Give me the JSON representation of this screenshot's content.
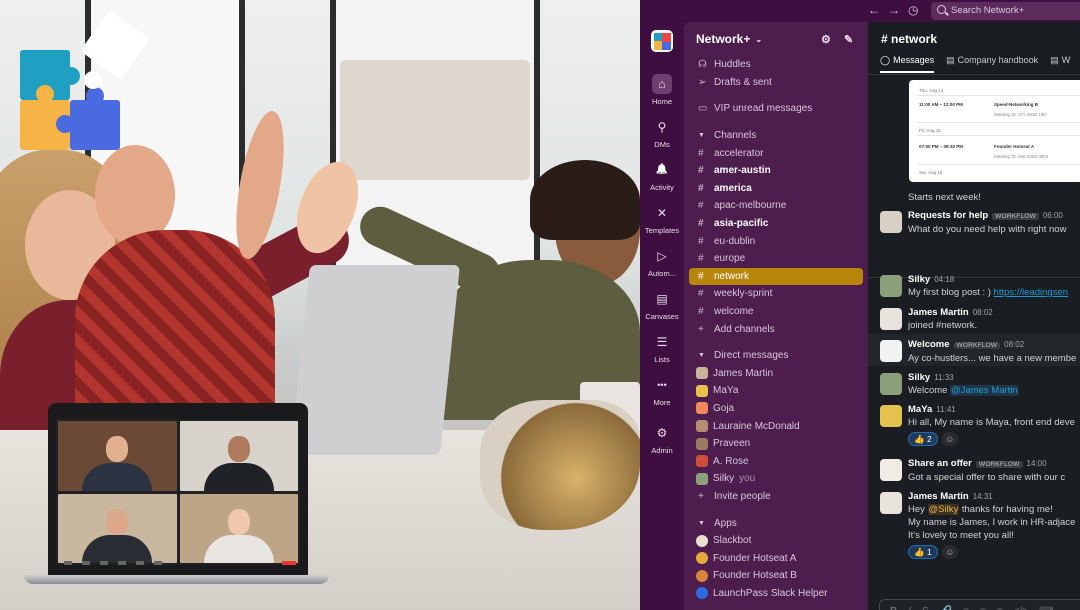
{
  "app": {
    "search_placeholder": "Search Network+",
    "workspace_name": "Network+"
  },
  "rail": [
    {
      "label": "Home",
      "icon": "home-icon"
    },
    {
      "label": "DMs",
      "icon": "dm-icon"
    },
    {
      "label": "Activity",
      "icon": "bell-icon"
    },
    {
      "label": "Templates",
      "icon": "templates-icon"
    },
    {
      "label": "Autom...",
      "icon": "automation-icon"
    },
    {
      "label": "Canvases",
      "icon": "canvas-icon"
    },
    {
      "label": "Lists",
      "icon": "list-icon"
    },
    {
      "label": "More",
      "icon": "more-icon"
    },
    {
      "label": "Admin",
      "icon": "gear-icon"
    }
  ],
  "sidebar": {
    "top_items": [
      "Huddles",
      "Drafts & sent"
    ],
    "vip": "VIP unread messages",
    "channels_header": "Channels",
    "channels": [
      {
        "name": "accelerator",
        "bold": false
      },
      {
        "name": "amer-austin",
        "bold": true
      },
      {
        "name": "america",
        "bold": true
      },
      {
        "name": "apac-melbourne",
        "bold": false
      },
      {
        "name": "asia-pacific",
        "bold": true
      },
      {
        "name": "eu-dublin",
        "bold": false
      },
      {
        "name": "europe",
        "bold": false
      },
      {
        "name": "network",
        "bold": false
      },
      {
        "name": "weekly-sprint",
        "bold": false
      },
      {
        "name": "welcome",
        "bold": false
      }
    ],
    "add_channels": "Add channels",
    "dm_header": "Direct messages",
    "dms": [
      "James Martin",
      "MaYa",
      "Goja",
      "Lauraine McDonald",
      "Praveen",
      "A. Rose",
      "Silky"
    ],
    "dm_you": "you",
    "invite": "Invite people",
    "apps_header": "Apps",
    "apps": [
      "Slackbot",
      "Founder Hotseat A",
      "Founder Hotseat B",
      "LaunchPass Slack Helper"
    ]
  },
  "channel": {
    "title": "# network",
    "tabs": [
      "Messages",
      "Company handbook",
      "W"
    ]
  },
  "schedule_card": {
    "day1": "Thu, Aug 14",
    "row1_time": "11:00 AM – 12:00 PM",
    "row1_title": "Speed-Networking B",
    "row1_meta": "Meeting ID: 872 8030 160",
    "day2": "Fri, Aug 15",
    "row2_time": "07:00 PM – 08:30 PM",
    "row2_title": "Founder Hotseat A",
    "row2_meta": "Meeting ID: 846 6200 0802",
    "day3": "Sat, Aug 16"
  },
  "messages": {
    "starts": "Starts next week!",
    "m1": {
      "name": "Requests for help",
      "badge": "WORKFLOW",
      "time": "06:00",
      "text": "What do you need help with right now"
    },
    "m2": {
      "name": "Silky",
      "time": "04:18",
      "text": "My first blog post : ) ",
      "link": "https://leadingsen"
    },
    "m3": {
      "name": "James Martin",
      "time": "08:02",
      "text": "joined #network."
    },
    "m4": {
      "name": "Welcome",
      "badge": "WORKFLOW",
      "time": "08:02",
      "text": "Ay co-hustlers... we have a new membe"
    },
    "m5": {
      "name": "Silky",
      "time": "11:33",
      "pre": "Welcome ",
      "mention": "@James Martin"
    },
    "m6": {
      "name": "MaYa",
      "time": "11:41",
      "text": "Hi all, My name is Maya, front end deve",
      "reaction": "👍 2"
    },
    "m7": {
      "name": "Share an offer",
      "badge": "WORKFLOW",
      "time": "14:00",
      "text": "Got a special offer to share with our c"
    },
    "m8": {
      "name": "James Martin",
      "time": "14:31",
      "pre": "Hey ",
      "mention": "@Silky",
      "post": " thanks for having me!",
      "line2": "My name is James, I work in HR-adjace",
      "line3": "It's lovely to meet you all!",
      "reaction": "👍 1"
    }
  },
  "composer": {
    "tools": [
      "B",
      "I",
      "S",
      "🔗",
      "≡",
      "≡",
      "≡",
      "</>",
      "⌨"
    ]
  }
}
